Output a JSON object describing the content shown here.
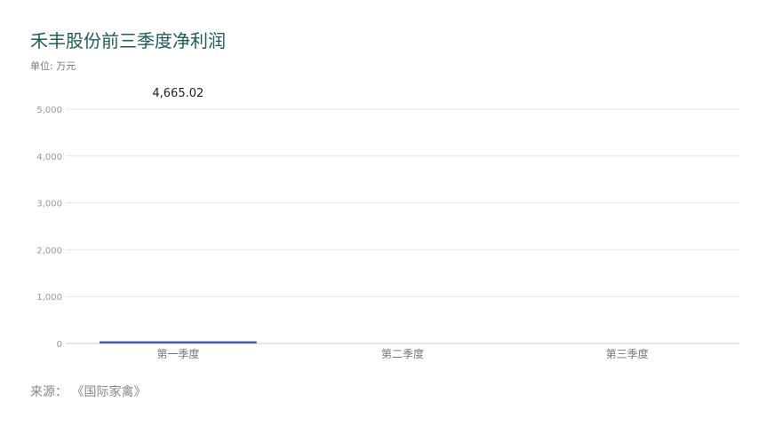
{
  "chart_data": {
    "type": "bar",
    "title": "禾丰股份前三季度净利润",
    "unit_label": "单位: 万元",
    "categories": [
      "第一季度",
      "第二季度",
      "第三季度"
    ],
    "values": [
      46.6502,
      0,
      0
    ],
    "data_labels": [
      "4,665.02",
      "",
      ""
    ],
    "ylim": [
      0,
      5000
    ],
    "yticks": [
      0,
      1000,
      2000,
      3000,
      4000,
      5000
    ],
    "ytick_labels": [
      "0",
      "1,000",
      "2,000",
      "3,000",
      "4,000",
      "5,000"
    ],
    "grid": true,
    "bar_color": "#4a5aa8",
    "grid_color": "#e6e6e6"
  },
  "source_text": "来源： 《国际家禽》"
}
